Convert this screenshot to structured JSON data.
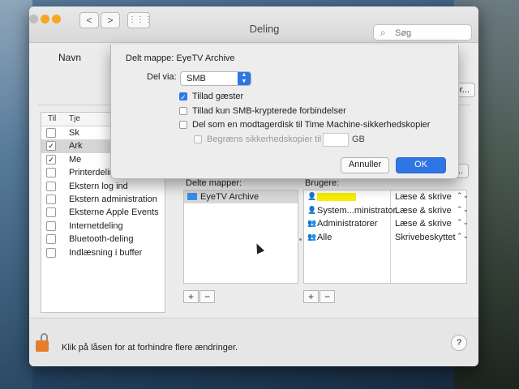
{
  "window": {
    "title": "Deling",
    "search_placeholder": "Søg",
    "nav_back": "<",
    "nav_forward": ">",
    "grid": "⋮⋮⋮"
  },
  "background_form": {
    "name_label": "Navn",
    "edit_btn": "er...",
    "settings_btn": "illinger..."
  },
  "services": {
    "header_on": "Til",
    "header_service": "Tje",
    "items": [
      {
        "label": "Sk",
        "checked": false,
        "selected": false
      },
      {
        "label": "Ark",
        "checked": true,
        "selected": true
      },
      {
        "label": "Me",
        "checked": true,
        "selected": false
      },
      {
        "label": "Printerdeling",
        "checked": false,
        "selected": false
      },
      {
        "label": "Ekstern log ind",
        "checked": false,
        "selected": false
      },
      {
        "label": "Ekstern administration",
        "checked": false,
        "selected": false
      },
      {
        "label": "Eksterne Apple Events",
        "checked": false,
        "selected": false
      },
      {
        "label": "Internetdeling",
        "checked": false,
        "selected": false
      },
      {
        "label": "Bluetooth-deling",
        "checked": false,
        "selected": false
      },
      {
        "label": "Indlæsning i buffer",
        "checked": false,
        "selected": false
      }
    ]
  },
  "shared_folders": {
    "label": "Delte mapper:",
    "items": [
      "EyeTV Archive"
    ],
    "add": "+",
    "remove": "−"
  },
  "users": {
    "label": "Brugere:",
    "rows": [
      {
        "name": "",
        "permission": "Læse & skrive",
        "icon": "person-icon"
      },
      {
        "name": "System...ministrator",
        "permission": "Læse & skrive",
        "icon": "person-icon"
      },
      {
        "name": "Administratorer",
        "permission": "Læse & skrive",
        "icon": "group-icon"
      },
      {
        "name": "Alle",
        "permission": "Skrivebeskyttet",
        "icon": "group-icon"
      }
    ],
    "add": "+",
    "remove": "−"
  },
  "footer": {
    "lock_text": "Klik på låsen for at forhindre flere ændringer.",
    "help": "?"
  },
  "sheet": {
    "folder_title": "Delt mappe: EyeTV Archive",
    "share_via_label": "Del via:",
    "share_via_value": "SMB",
    "options": [
      {
        "label": "Tillad gæster",
        "checked": true,
        "disabled": false
      },
      {
        "label": "Tillad kun SMB-krypterede forbindelser",
        "checked": false,
        "disabled": false
      },
      {
        "label": "Del som en modtagerdisk til Time Machine-sikkerhedskopier",
        "checked": false,
        "disabled": false
      },
      {
        "label": "Begræns sikkerhedskopier til",
        "checked": false,
        "disabled": true
      }
    ],
    "limit_unit": "GB",
    "cancel": "Annuller",
    "ok": "OK"
  },
  "colors": {
    "accent": "#2e76e4",
    "lock": "#e57e2a"
  }
}
